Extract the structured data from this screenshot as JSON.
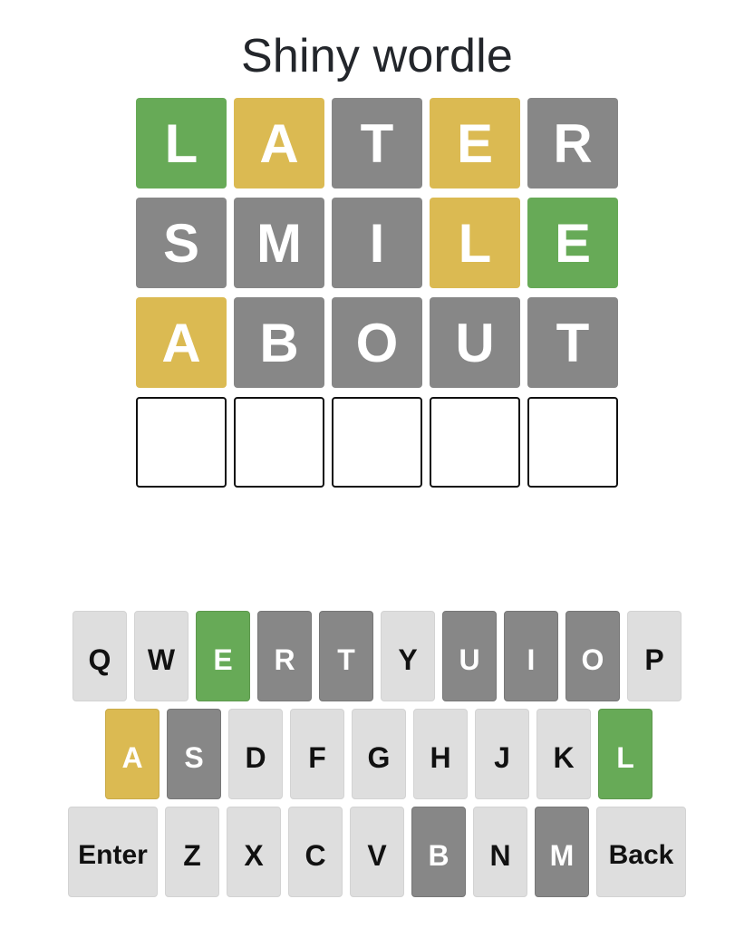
{
  "title": "Shiny wordle",
  "board": [
    [
      {
        "letter": "L",
        "state": "correct"
      },
      {
        "letter": "A",
        "state": "present"
      },
      {
        "letter": "T",
        "state": "absent"
      },
      {
        "letter": "E",
        "state": "present"
      },
      {
        "letter": "R",
        "state": "absent"
      }
    ],
    [
      {
        "letter": "S",
        "state": "absent"
      },
      {
        "letter": "M",
        "state": "absent"
      },
      {
        "letter": "I",
        "state": "absent"
      },
      {
        "letter": "L",
        "state": "present"
      },
      {
        "letter": "E",
        "state": "correct"
      }
    ],
    [
      {
        "letter": "A",
        "state": "present"
      },
      {
        "letter": "B",
        "state": "absent"
      },
      {
        "letter": "O",
        "state": "absent"
      },
      {
        "letter": "U",
        "state": "absent"
      },
      {
        "letter": "T",
        "state": "absent"
      }
    ],
    [
      {
        "letter": "",
        "state": "empty"
      },
      {
        "letter": "",
        "state": "empty"
      },
      {
        "letter": "",
        "state": "empty"
      },
      {
        "letter": "",
        "state": "empty"
      },
      {
        "letter": "",
        "state": "empty"
      }
    ]
  ],
  "keyboard": {
    "rows": [
      [
        {
          "label": "Q",
          "state": "normal"
        },
        {
          "label": "W",
          "state": "normal"
        },
        {
          "label": "E",
          "state": "correct"
        },
        {
          "label": "R",
          "state": "absent"
        },
        {
          "label": "T",
          "state": "absent"
        },
        {
          "label": "Y",
          "state": "normal"
        },
        {
          "label": "U",
          "state": "absent"
        },
        {
          "label": "I",
          "state": "absent"
        },
        {
          "label": "O",
          "state": "absent"
        },
        {
          "label": "P",
          "state": "normal"
        }
      ],
      [
        {
          "label": "A",
          "state": "present"
        },
        {
          "label": "S",
          "state": "absent"
        },
        {
          "label": "D",
          "state": "normal"
        },
        {
          "label": "F",
          "state": "normal"
        },
        {
          "label": "G",
          "state": "normal"
        },
        {
          "label": "H",
          "state": "normal"
        },
        {
          "label": "J",
          "state": "normal"
        },
        {
          "label": "K",
          "state": "normal"
        },
        {
          "label": "L",
          "state": "correct"
        }
      ],
      [
        {
          "label": "Enter",
          "state": "normal",
          "wide": true
        },
        {
          "label": "Z",
          "state": "normal"
        },
        {
          "label": "X",
          "state": "normal"
        },
        {
          "label": "C",
          "state": "normal"
        },
        {
          "label": "V",
          "state": "normal"
        },
        {
          "label": "B",
          "state": "absent"
        },
        {
          "label": "N",
          "state": "normal"
        },
        {
          "label": "M",
          "state": "absent"
        },
        {
          "label": "Back",
          "state": "normal",
          "wide": true
        }
      ]
    ]
  },
  "colors": {
    "correct": "#67aa57",
    "present": "#dbba52",
    "absent": "#878787",
    "key": "#dedede"
  }
}
